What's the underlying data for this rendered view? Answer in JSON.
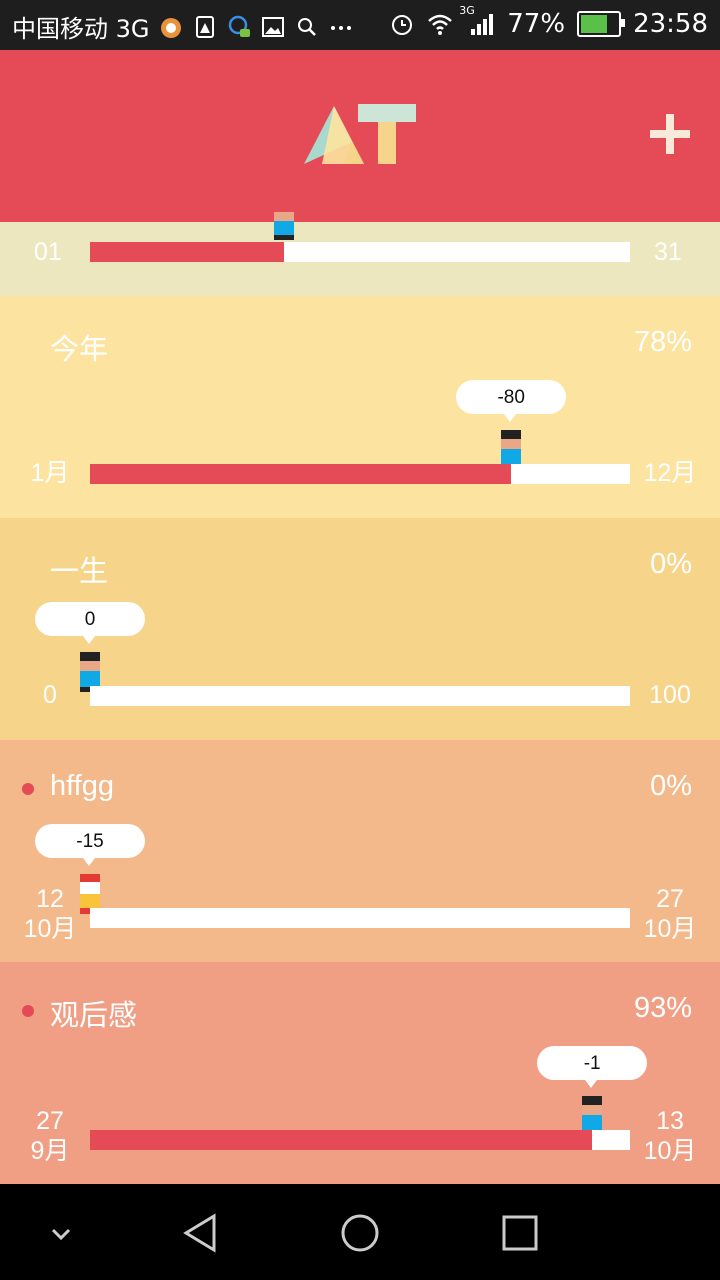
{
  "status_bar": {
    "carrier": "中国移动 3G",
    "network": "3G",
    "battery": "77%",
    "battery_level": 0.77,
    "time": "23:58",
    "icons": [
      "app-icon",
      "sim-warning-icon",
      "qq-icon",
      "image-icon",
      "search-icon",
      "more-icon",
      "alarm-icon",
      "wifi-icon",
      "signal-icon",
      "battery-icon"
    ]
  },
  "header": {
    "logo_text": "AT",
    "add_icon": "plus-icon"
  },
  "month_row": {
    "start": "01",
    "end": "31",
    "progress": 0.36
  },
  "cards": [
    {
      "id": "year",
      "title": "今年",
      "percent": "78%",
      "progress": 0.78,
      "bubble": "-80",
      "start_top": "",
      "start_bottom": "1月",
      "end_top": "",
      "end_bottom": "12月",
      "marker": "person",
      "has_dot": false,
      "bg": "#fde3a0"
    },
    {
      "id": "life",
      "title": "一生",
      "percent": "0%",
      "progress": 0,
      "bubble": "0",
      "start_top": "",
      "start_bottom": "0",
      "end_top": "",
      "end_bottom": "100",
      "marker": "person",
      "has_dot": false,
      "bg": "#f6d48a"
    },
    {
      "id": "hffgg",
      "title": "hffgg",
      "percent": "0%",
      "progress": 0,
      "bubble": "-15",
      "start_top": "12",
      "start_bottom": "10月",
      "end_top": "27",
      "end_bottom": "10月",
      "marker": "flag",
      "has_dot": true,
      "bg": "#f3b98a"
    },
    {
      "id": "guanhougan",
      "title": "观后感",
      "percent": "93%",
      "progress": 0.93,
      "bubble": "-1",
      "start_top": "27",
      "start_bottom": "9月",
      "end_top": "13",
      "end_bottom": "10月",
      "marker": "person",
      "has_dot": true,
      "bg": "#f09f84"
    }
  ],
  "nav_bar": {
    "buttons": [
      "collapse-icon",
      "back-icon",
      "home-icon",
      "recents-icon"
    ]
  },
  "colors": {
    "accent": "#e54b56",
    "header_bg": "#e54b56",
    "month_row_bg": "#ede7bf",
    "nav_bg": "#000000"
  }
}
